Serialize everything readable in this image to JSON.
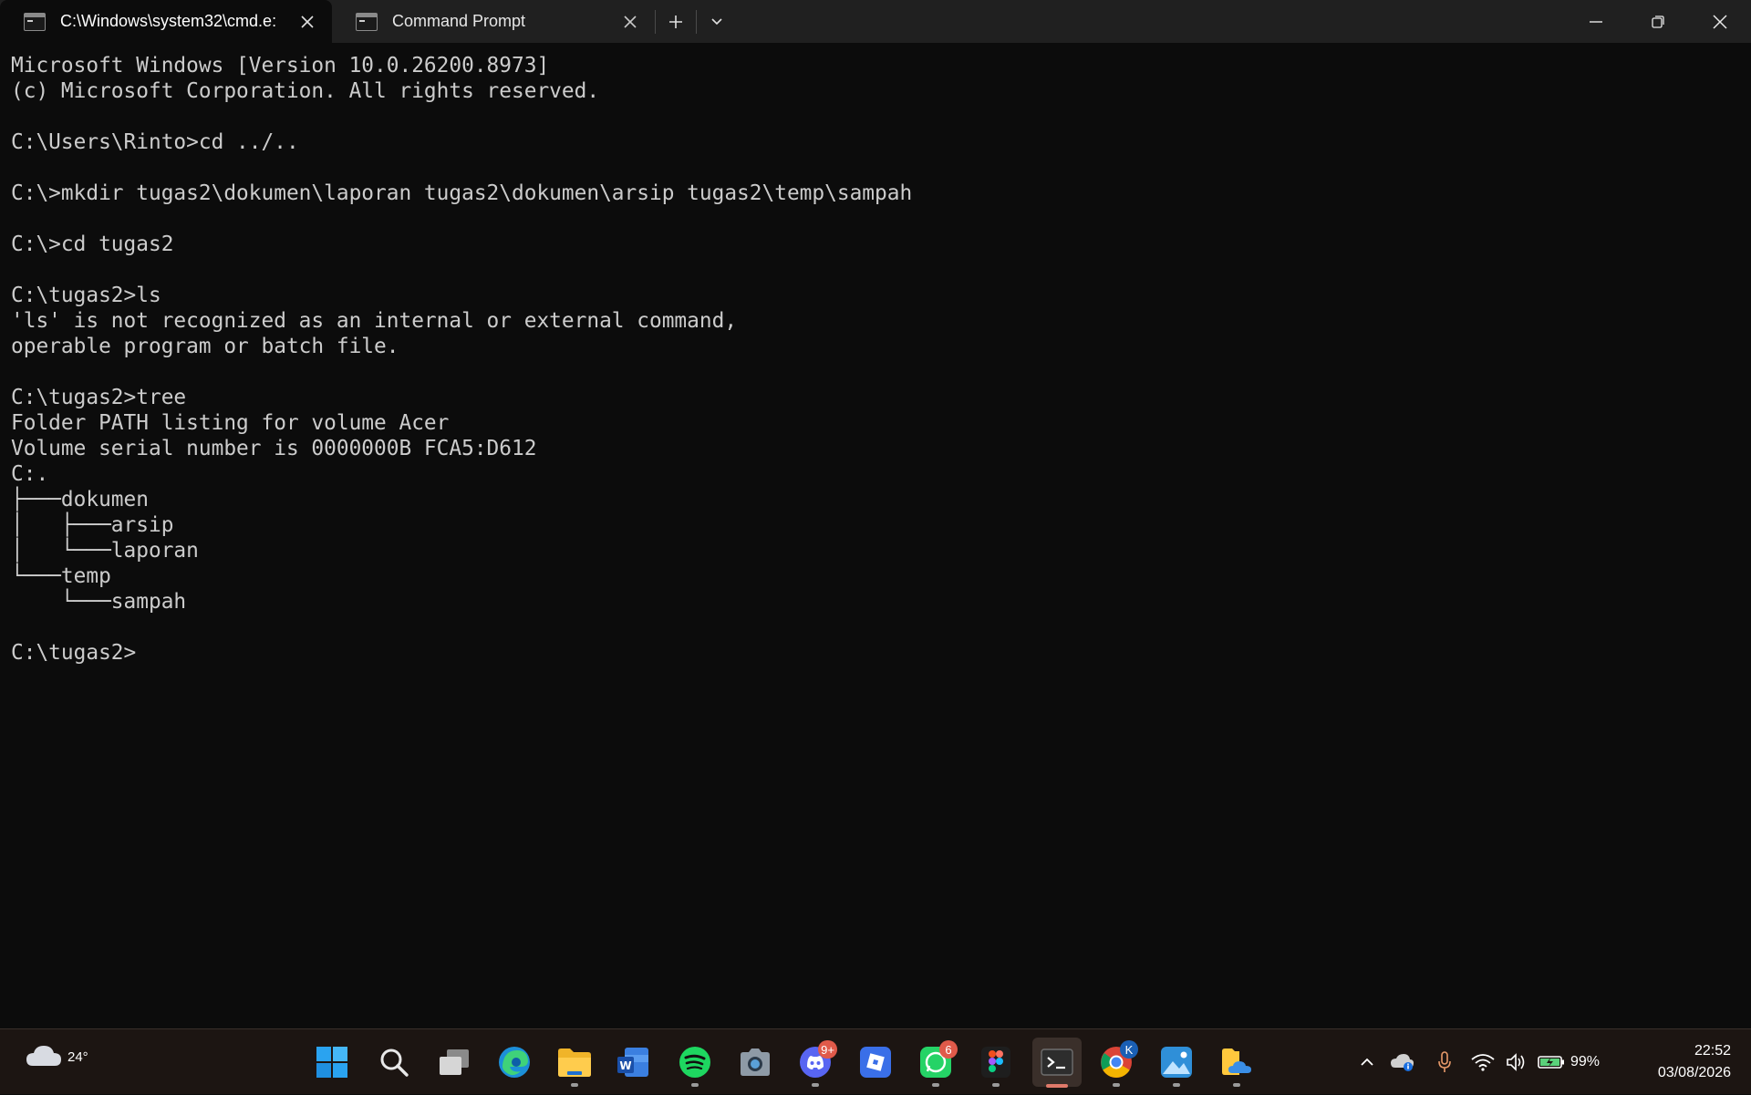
{
  "window": {
    "tabs": [
      {
        "title": "C:\\Windows\\system32\\cmd.e:",
        "active": true,
        "icon": "cmd-icon"
      },
      {
        "title": "Command Prompt",
        "active": false,
        "icon": "cmd-icon"
      }
    ],
    "new_tab_icon": "plus-icon",
    "dropdown_icon": "chevron-down-icon"
  },
  "terminal": {
    "lines": [
      "Microsoft Windows [Version 10.0.26200.8973]",
      "(c) Microsoft Corporation. All rights reserved.",
      "",
      "C:\\Users\\Rinto>cd ../..",
      "",
      "C:\\>mkdir tugas2\\dokumen\\laporan tugas2\\dokumen\\arsip tugas2\\temp\\sampah",
      "",
      "C:\\>cd tugas2",
      "",
      "C:\\tugas2>ls",
      "'ls' is not recognized as an internal or external command,",
      "operable program or batch file.",
      "",
      "C:\\tugas2>tree",
      "Folder PATH listing for volume Acer",
      "Volume serial number is 0000000B FCA5:D612",
      "C:.",
      "├───dokumen",
      "│   ├───arsip",
      "│   └───laporan",
      "└───temp",
      "    └───sampah",
      "",
      "C:\\tugas2>"
    ]
  },
  "taskbar": {
    "weather_temp": "24°",
    "apps": [
      {
        "name": "start",
        "icon": "windows-logo-icon"
      },
      {
        "name": "search",
        "icon": "search-icon"
      },
      {
        "name": "task-view",
        "icon": "task-view-icon"
      },
      {
        "name": "edge",
        "icon": "edge-icon"
      },
      {
        "name": "file-explorer",
        "icon": "folder-icon"
      },
      {
        "name": "word",
        "icon": "word-icon"
      },
      {
        "name": "spotify",
        "icon": "spotify-icon"
      },
      {
        "name": "camera",
        "icon": "camera-icon"
      },
      {
        "name": "discord",
        "icon": "discord-icon",
        "badge": "9+"
      },
      {
        "name": "roblox",
        "icon": "roblox-icon"
      },
      {
        "name": "whatsapp",
        "icon": "whatsapp-icon",
        "badge": "6"
      },
      {
        "name": "figma",
        "icon": "figma-icon"
      },
      {
        "name": "terminal",
        "icon": "terminal-icon"
      },
      {
        "name": "chrome",
        "icon": "chrome-icon",
        "badge": "K"
      },
      {
        "name": "photos",
        "icon": "photos-icon"
      },
      {
        "name": "onedrive-folder",
        "icon": "onedrive-folder-icon"
      }
    ],
    "battery": "99%",
    "time": "22:52",
    "date": "03/08/2026"
  },
  "colors": {
    "terminal_bg": "#0c0c0c",
    "terminal_fg": "#cccccc",
    "titlebar_bg": "#202020",
    "taskbar_bg": "#1c1512",
    "active_indicator": "#e07a6a"
  }
}
